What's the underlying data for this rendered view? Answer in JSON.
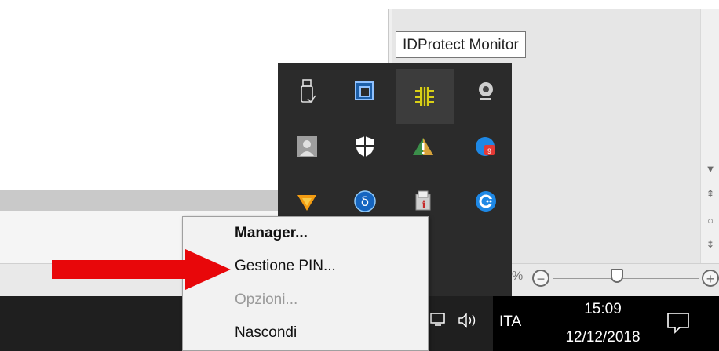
{
  "tooltip": {
    "text": "IDProtect Monitor"
  },
  "context_menu": {
    "items": [
      {
        "label": "Manager...",
        "bold": true,
        "enabled": true
      },
      {
        "label": "Gestione PIN...",
        "bold": false,
        "enabled": true
      },
      {
        "label": "Opzioni...",
        "bold": false,
        "enabled": false
      },
      {
        "label": "Nascondi",
        "bold": false,
        "enabled": true
      }
    ]
  },
  "tray_flyout": {
    "icons": [
      {
        "name": "usb-drive-icon"
      },
      {
        "name": "window-restore-icon"
      },
      {
        "name": "idprotect-monitor-icon",
        "highlighted": true
      },
      {
        "name": "webcam-icon"
      },
      {
        "name": "user-avatar-icon"
      },
      {
        "name": "windows-defender-shield-icon"
      },
      {
        "name": "drive-warning-icon"
      },
      {
        "name": "red-app-icon"
      },
      {
        "name": "vlc-like-icon"
      },
      {
        "name": "delta-icon"
      },
      {
        "name": "info-tool-icon"
      },
      {
        "name": "blue-circle-app-icon"
      },
      {
        "name": "orange-app-icon"
      }
    ]
  },
  "statusbar": {
    "zoom_suffix": "%",
    "zoom_minus": "−",
    "zoom_plus": "+"
  },
  "taskbar": {
    "language": "ITA",
    "time": "15:09",
    "date": "12/12/2018"
  },
  "colors": {
    "arrow": "#e8070a",
    "taskbar": "#1f1f1f",
    "flyout": "#2b2b2b",
    "menu": "#f2f2f2"
  }
}
